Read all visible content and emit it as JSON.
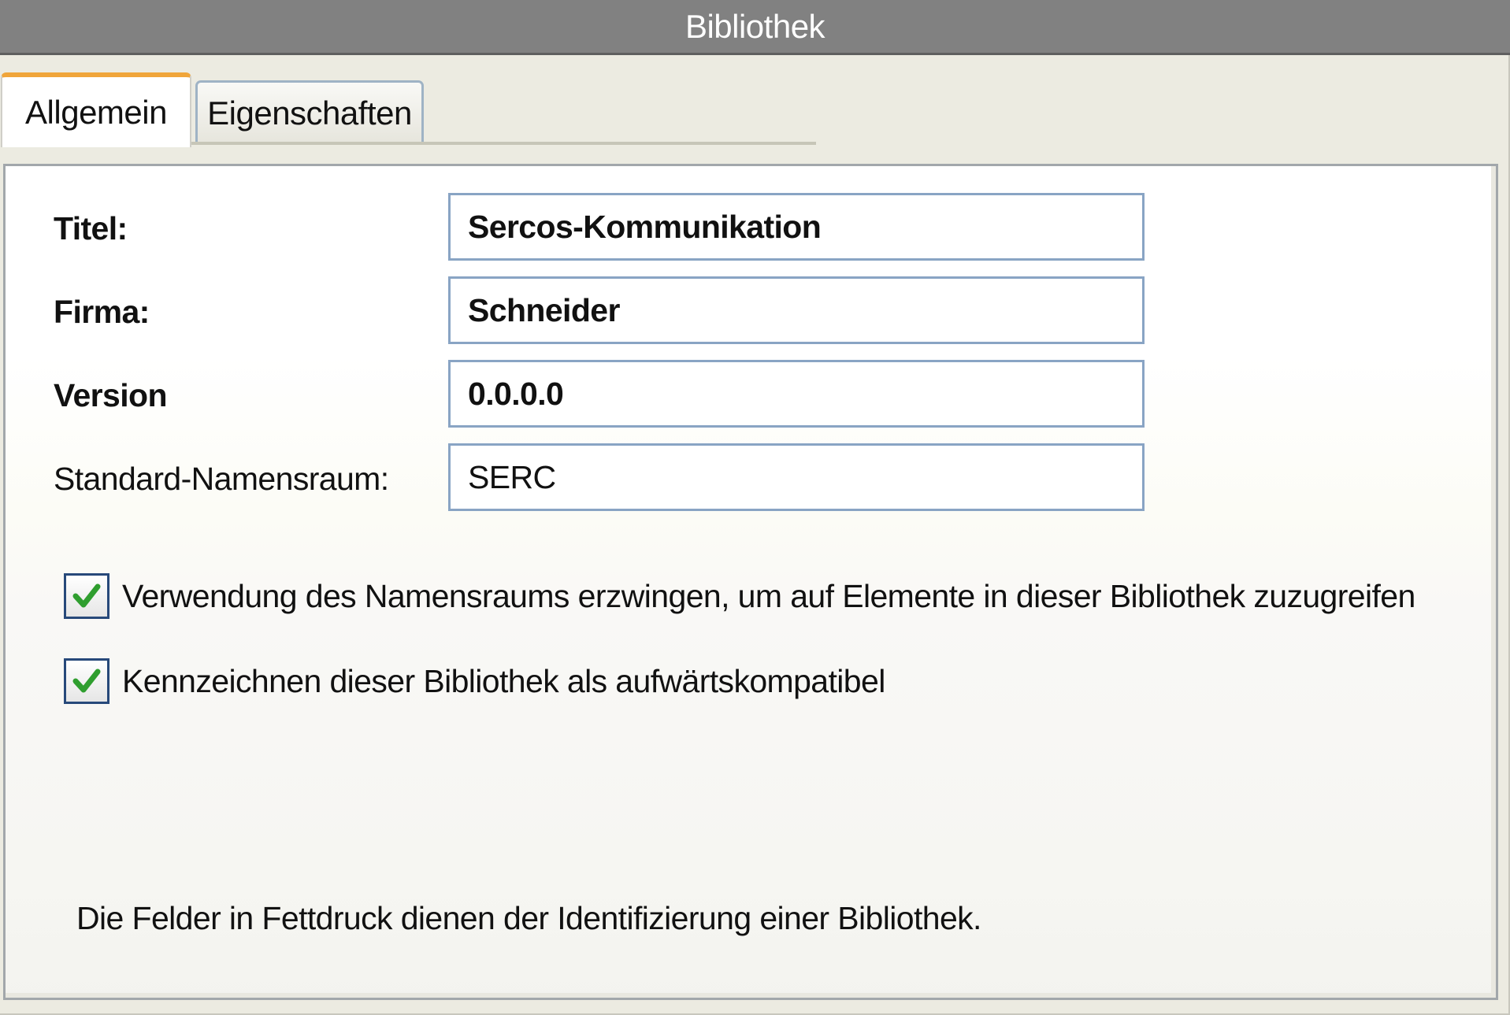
{
  "window": {
    "title": "Bibliothek"
  },
  "tabs": [
    {
      "label": "Allgemein",
      "active": true
    },
    {
      "label": "Eigenschaften",
      "active": false
    }
  ],
  "form": {
    "title": {
      "label": "Titel:",
      "value": "Sercos-Kommunikation"
    },
    "company": {
      "label": "Firma:",
      "value": "Schneider"
    },
    "version": {
      "label": "Version",
      "value": "0.0.0.0"
    },
    "namespace": {
      "label": "Standard-Namensraum:",
      "value": "SERC"
    }
  },
  "options": [
    {
      "label": "Verwendung des Namensraums erzwingen, um auf Elemente in dieser Bibliothek zuzugreifen",
      "checked": true
    },
    {
      "label": "Kennzeichnen dieser Bibliothek als aufwärtskompatibel",
      "checked": true
    }
  ],
  "hint": "Die Felder in Fettdruck dienen der Identifizierung einer Bibliothek.",
  "colors": {
    "titlebar": "#818181",
    "active_tab_accent": "#f0a53a",
    "check_green": "#2f9e2f",
    "field_border": "#89a4c4"
  },
  "icons": {
    "checkbox": "checkmark-icon"
  }
}
